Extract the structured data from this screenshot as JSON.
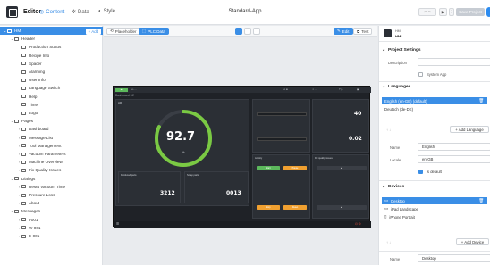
{
  "topbar": {
    "app_title": "Editor",
    "tabs": [
      {
        "label": "Content",
        "icon": "content-icon",
        "active": true
      },
      {
        "label": "Data",
        "icon": "data-icon",
        "active": false
      },
      {
        "label": "Style",
        "icon": "style-icon",
        "active": false
      }
    ],
    "project_name": "Standard-App",
    "save_label": "Save Project"
  },
  "left": {
    "add_label": "+ Add",
    "tree": [
      {
        "label": "HMI",
        "level": 0,
        "expand": "v",
        "selected": true
      },
      {
        "label": "Header",
        "level": 1,
        "expand": "v"
      },
      {
        "label": "Production Status",
        "level": 2
      },
      {
        "label": "Recipe Info",
        "level": 2
      },
      {
        "label": "Spacer",
        "level": 2
      },
      {
        "label": "Alarming",
        "level": 2
      },
      {
        "label": "User Info",
        "level": 2
      },
      {
        "label": "Language Switch",
        "level": 2
      },
      {
        "label": "Help",
        "level": 2
      },
      {
        "label": "Time",
        "level": 2
      },
      {
        "label": "Logo",
        "level": 2
      },
      {
        "label": "Pages",
        "level": 1,
        "expand": "v"
      },
      {
        "label": "Dashboard",
        "level": 2,
        "expand": ">"
      },
      {
        "label": "Message List",
        "level": 2,
        "expand": ">"
      },
      {
        "label": "Tool Management",
        "level": 2,
        "expand": ">"
      },
      {
        "label": "Vacuum Parameters",
        "level": 2,
        "expand": ">"
      },
      {
        "label": "Machine Overview",
        "level": 2,
        "expand": ">"
      },
      {
        "label": "Fix Quality Issues",
        "level": 2,
        "expand": ">"
      },
      {
        "label": "Dialogs",
        "level": 1,
        "expand": "v"
      },
      {
        "label": "Reset Vacuum Time",
        "level": 2,
        "expand": ">"
      },
      {
        "label": "Pressure Loss",
        "level": 2,
        "expand": ">"
      },
      {
        "label": "About",
        "level": 2,
        "expand": ">"
      },
      {
        "label": "Messages",
        "level": 1,
        "expand": "v"
      },
      {
        "label": "I-001",
        "level": 2,
        "expand": ">"
      },
      {
        "label": "W-001",
        "level": 2,
        "expand": ">"
      },
      {
        "label": "E-001",
        "level": 2,
        "expand": ">"
      }
    ]
  },
  "canvas": {
    "placeholder_label": "Placeholder",
    "plc_label": "PLC Data",
    "edit_label": "Edit",
    "test_label": "Test"
  },
  "hmi": {
    "subtitle": "Dashboard 1/2",
    "gauge_panel_label": "HMI",
    "gauge_value": "92.7",
    "gauge_fraction": 0.82,
    "gauge_unit": "%",
    "tile1_label": "Produced parts",
    "tile1_value": "3212",
    "tile2_label": "Scrap parts",
    "tile2_value": "0013",
    "stat1_value": "40",
    "stat2_value": "0.02",
    "activity_label": "Activity",
    "fix_label": "Fix quality issues",
    "btn_start": "Start",
    "btn_pause": "Pause",
    "btn_stop": "Stop",
    "btn_reset": "Reset"
  },
  "right": {
    "header_sub": "HMI",
    "header_title": "HMI",
    "project_settings": "Project Settings",
    "description_label": "Description",
    "system_app_label": "System App",
    "languages": "Languages",
    "language_items": [
      "English (en-GB) (default)",
      "Deutsch (de-DE)"
    ],
    "add_language": "+ Add Language",
    "name_label": "Name",
    "name_value": "English",
    "locale_label": "Locale",
    "locale_value": "en-GB",
    "is_default_label": "is default",
    "devices": "Devices",
    "device_items": [
      "Desktop",
      "iPad Landscape",
      "iPhone Portrait"
    ],
    "add_device": "+ Add Device",
    "device_name_label": "Name",
    "device_name_value": "Desktop"
  },
  "colors": {
    "accent": "#3a8ee6",
    "hmi_bg": "#1f2227",
    "gauge_green": "#7ac943",
    "orange": "#f0a030",
    "red": "#e74c3c"
  }
}
